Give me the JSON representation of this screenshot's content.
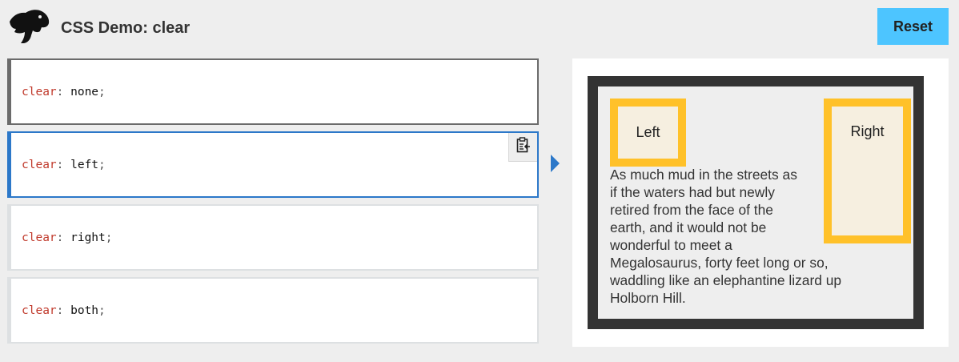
{
  "header": {
    "logo_icon": "mdn-dinosaur-icon",
    "title": "CSS Demo: clear",
    "reset_label": "Reset"
  },
  "options": [
    {
      "property": "clear",
      "colon": ":",
      "value": " none",
      "semicolon": ";",
      "state": "hover"
    },
    {
      "property": "clear",
      "colon": ":",
      "value": " left",
      "semicolon": ";",
      "state": "selected"
    },
    {
      "property": "clear",
      "colon": ":",
      "value": " right",
      "semicolon": ";",
      "state": "normal"
    },
    {
      "property": "clear",
      "colon": ":",
      "value": " both",
      "semicolon": ";",
      "state": "normal"
    }
  ],
  "copy_icon": "clipboard-copy-icon",
  "output": {
    "left_label": "Left",
    "right_label": "Right",
    "paragraph_lines": [
      "As much mud in the streets as",
      "if the waters had but newly",
      "retired from the face of the",
      "earth, and it would not be",
      "wonderful to meet a",
      "Megalosaurus, forty feet long or so,",
      "waddling like an elephantine lizard up",
      "Holborn Hill."
    ]
  },
  "colors": {
    "accent": "#2c78c9",
    "reset_button": "#4dc5ff",
    "float_border": "#ffc129",
    "float_fill": "#f6efe0",
    "example_border": "#333333",
    "property_text": "#c0392b"
  }
}
